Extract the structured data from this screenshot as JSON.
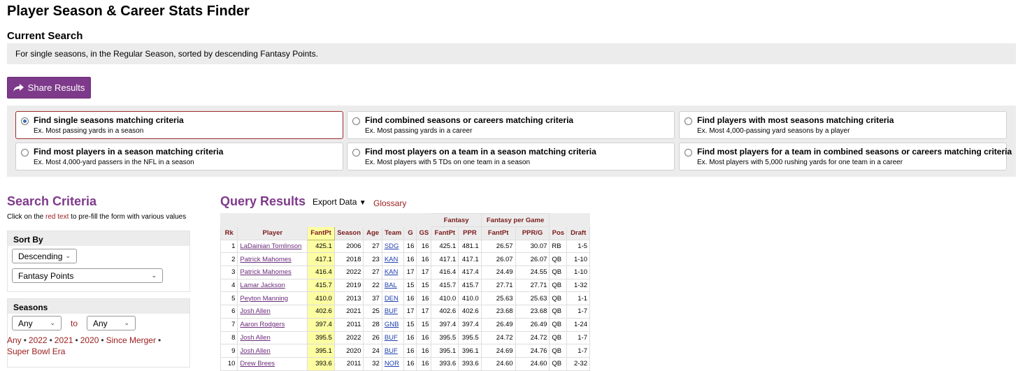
{
  "page_title": "Player Season & Career Stats Finder",
  "current_search": {
    "title": "Current Search",
    "description": "For single seasons, in the Regular Season, sorted by descending Fantasy Points."
  },
  "share_button": {
    "label": "Share Results",
    "icon": "share-arrow-icon"
  },
  "options": [
    {
      "title": "Find single seasons matching criteria",
      "example": "Ex. Most passing yards in a season",
      "selected": true
    },
    {
      "title": "Find combined seasons or careers matching criteria",
      "example": "Ex. Most passing yards in a career",
      "selected": false
    },
    {
      "title": "Find players with most seasons matching criteria",
      "example": "Ex. Most 4,000-passing yard seasons by a player",
      "selected": false
    },
    {
      "title": "Find most players in a season matching criteria",
      "example": "Ex. Most 4,000-yard passers in the NFL in a season",
      "selected": false
    },
    {
      "title": "Find most players on a team in a season matching criteria",
      "example": "Ex. Most players with 5 TDs on one team in a season",
      "selected": false
    },
    {
      "title": "Find most players for a team in combined seasons or careers matching criteria",
      "example": "Ex. Most players with 5,000 rushing yards for one team in a career",
      "selected": false
    }
  ],
  "search_criteria": {
    "title": "Search Criteria",
    "hint_prefix": "Click on the ",
    "hint_red": "red text",
    "hint_suffix": " to pre-fill the form with various values",
    "sort_by": {
      "label": "Sort By",
      "order": "Descending",
      "field": "Fantasy Points"
    },
    "seasons": {
      "label": "Seasons",
      "from": "Any",
      "to_label": "to",
      "to": "Any",
      "quick_links": [
        "Any",
        "2022",
        "2021",
        "2020",
        "Since Merger",
        "Super Bowl Era"
      ]
    }
  },
  "query_results": {
    "title": "Query Results",
    "export_label": "Export Data",
    "export_caret": "▼",
    "glossary_label": "Glossary",
    "over_headers": {
      "fantasy": "Fantasy",
      "per_game": "Fantasy per Game"
    },
    "columns": [
      "Rk",
      "Player",
      "FantPt",
      "Season",
      "Age",
      "Team",
      "G",
      "GS",
      "FantPt",
      "PPR",
      "FantPt",
      "PPR/G",
      "Pos",
      "Draft"
    ],
    "rows": [
      [
        "1",
        "LaDainian Tomlinson",
        "425.1",
        "2006",
        "27",
        "SDG",
        "16",
        "16",
        "425.1",
        "481.1",
        "26.57",
        "30.07",
        "RB",
        "1-5"
      ],
      [
        "2",
        "Patrick Mahomes",
        "417.1",
        "2018",
        "23",
        "KAN",
        "16",
        "16",
        "417.1",
        "417.1",
        "26.07",
        "26.07",
        "QB",
        "1-10"
      ],
      [
        "3",
        "Patrick Mahomes",
        "416.4",
        "2022",
        "27",
        "KAN",
        "17",
        "17",
        "416.4",
        "417.4",
        "24.49",
        "24.55",
        "QB",
        "1-10"
      ],
      [
        "4",
        "Lamar Jackson",
        "415.7",
        "2019",
        "22",
        "BAL",
        "15",
        "15",
        "415.7",
        "415.7",
        "27.71",
        "27.71",
        "QB",
        "1-32"
      ],
      [
        "5",
        "Peyton Manning",
        "410.0",
        "2013",
        "37",
        "DEN",
        "16",
        "16",
        "410.0",
        "410.0",
        "25.63",
        "25.63",
        "QB",
        "1-1"
      ],
      [
        "6",
        "Josh Allen",
        "402.6",
        "2021",
        "25",
        "BUF",
        "17",
        "17",
        "402.6",
        "402.6",
        "23.68",
        "23.68",
        "QB",
        "1-7"
      ],
      [
        "7",
        "Aaron Rodgers",
        "397.4",
        "2011",
        "28",
        "GNB",
        "15",
        "15",
        "397.4",
        "397.4",
        "26.49",
        "26.49",
        "QB",
        "1-24"
      ],
      [
        "8",
        "Josh Allen",
        "395.5",
        "2022",
        "26",
        "BUF",
        "16",
        "16",
        "395.5",
        "395.5",
        "24.72",
        "24.72",
        "QB",
        "1-7"
      ],
      [
        "9",
        "Josh Allen",
        "395.1",
        "2020",
        "24",
        "BUF",
        "16",
        "16",
        "395.1",
        "396.1",
        "24.69",
        "24.76",
        "QB",
        "1-7"
      ],
      [
        "10",
        "Drew Brees",
        "393.6",
        "2011",
        "32",
        "NOR",
        "16",
        "16",
        "393.6",
        "393.6",
        "24.60",
        "24.60",
        "QB",
        "2-32"
      ]
    ]
  }
}
